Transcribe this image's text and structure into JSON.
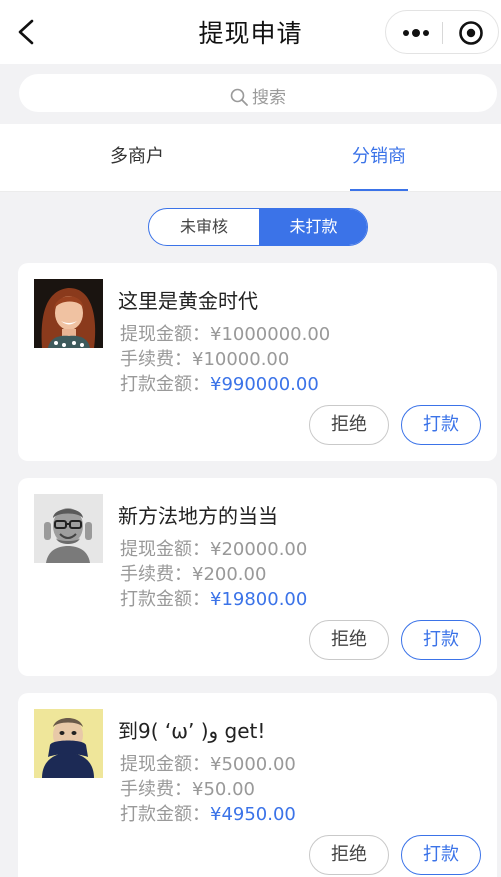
{
  "nav": {
    "title": "提现申请",
    "back_icon": "chevron-left-icon",
    "more_icon": "more-dots-icon",
    "close_icon": "target-circle-icon"
  },
  "search": {
    "placeholder": "搜索",
    "icon": "search-icon"
  },
  "tabs": [
    {
      "label": "多商户",
      "active": false
    },
    {
      "label": "分销商",
      "active": true
    }
  ],
  "segment": [
    {
      "label": "未审核",
      "active": false
    },
    {
      "label": "未打款",
      "active": true
    }
  ],
  "accent_color": "#3b73e8",
  "cards": [
    {
      "name": "这里是黄金时代",
      "amount_label": "提现金额：",
      "amount": "¥1000000.00",
      "fee_label": "手续费：",
      "fee": "¥10000.00",
      "paid_label": "打款金额：",
      "paid": "¥990000.00",
      "reject_label": "拒绝",
      "pay_label": "打款",
      "avatar": "woman-portrait-avatar"
    },
    {
      "name": "新方法地方的当当",
      "amount_label": "提现金额：",
      "amount": "¥20000.00",
      "fee_label": "手续费：",
      "fee": "¥200.00",
      "paid_label": "打款金额：",
      "paid": "¥19800.00",
      "reject_label": "拒绝",
      "pay_label": "打款",
      "avatar": "man-glasses-avatar"
    },
    {
      "name": "到9( ‘ω’ )و get!",
      "amount_label": "提现金额：",
      "amount": "¥5000.00",
      "fee_label": "手续费：",
      "fee": "¥50.00",
      "paid_label": "打款金额：",
      "paid": "¥4950.00",
      "reject_label": "拒绝",
      "pay_label": "打款",
      "avatar": "man-scarf-avatar"
    }
  ]
}
